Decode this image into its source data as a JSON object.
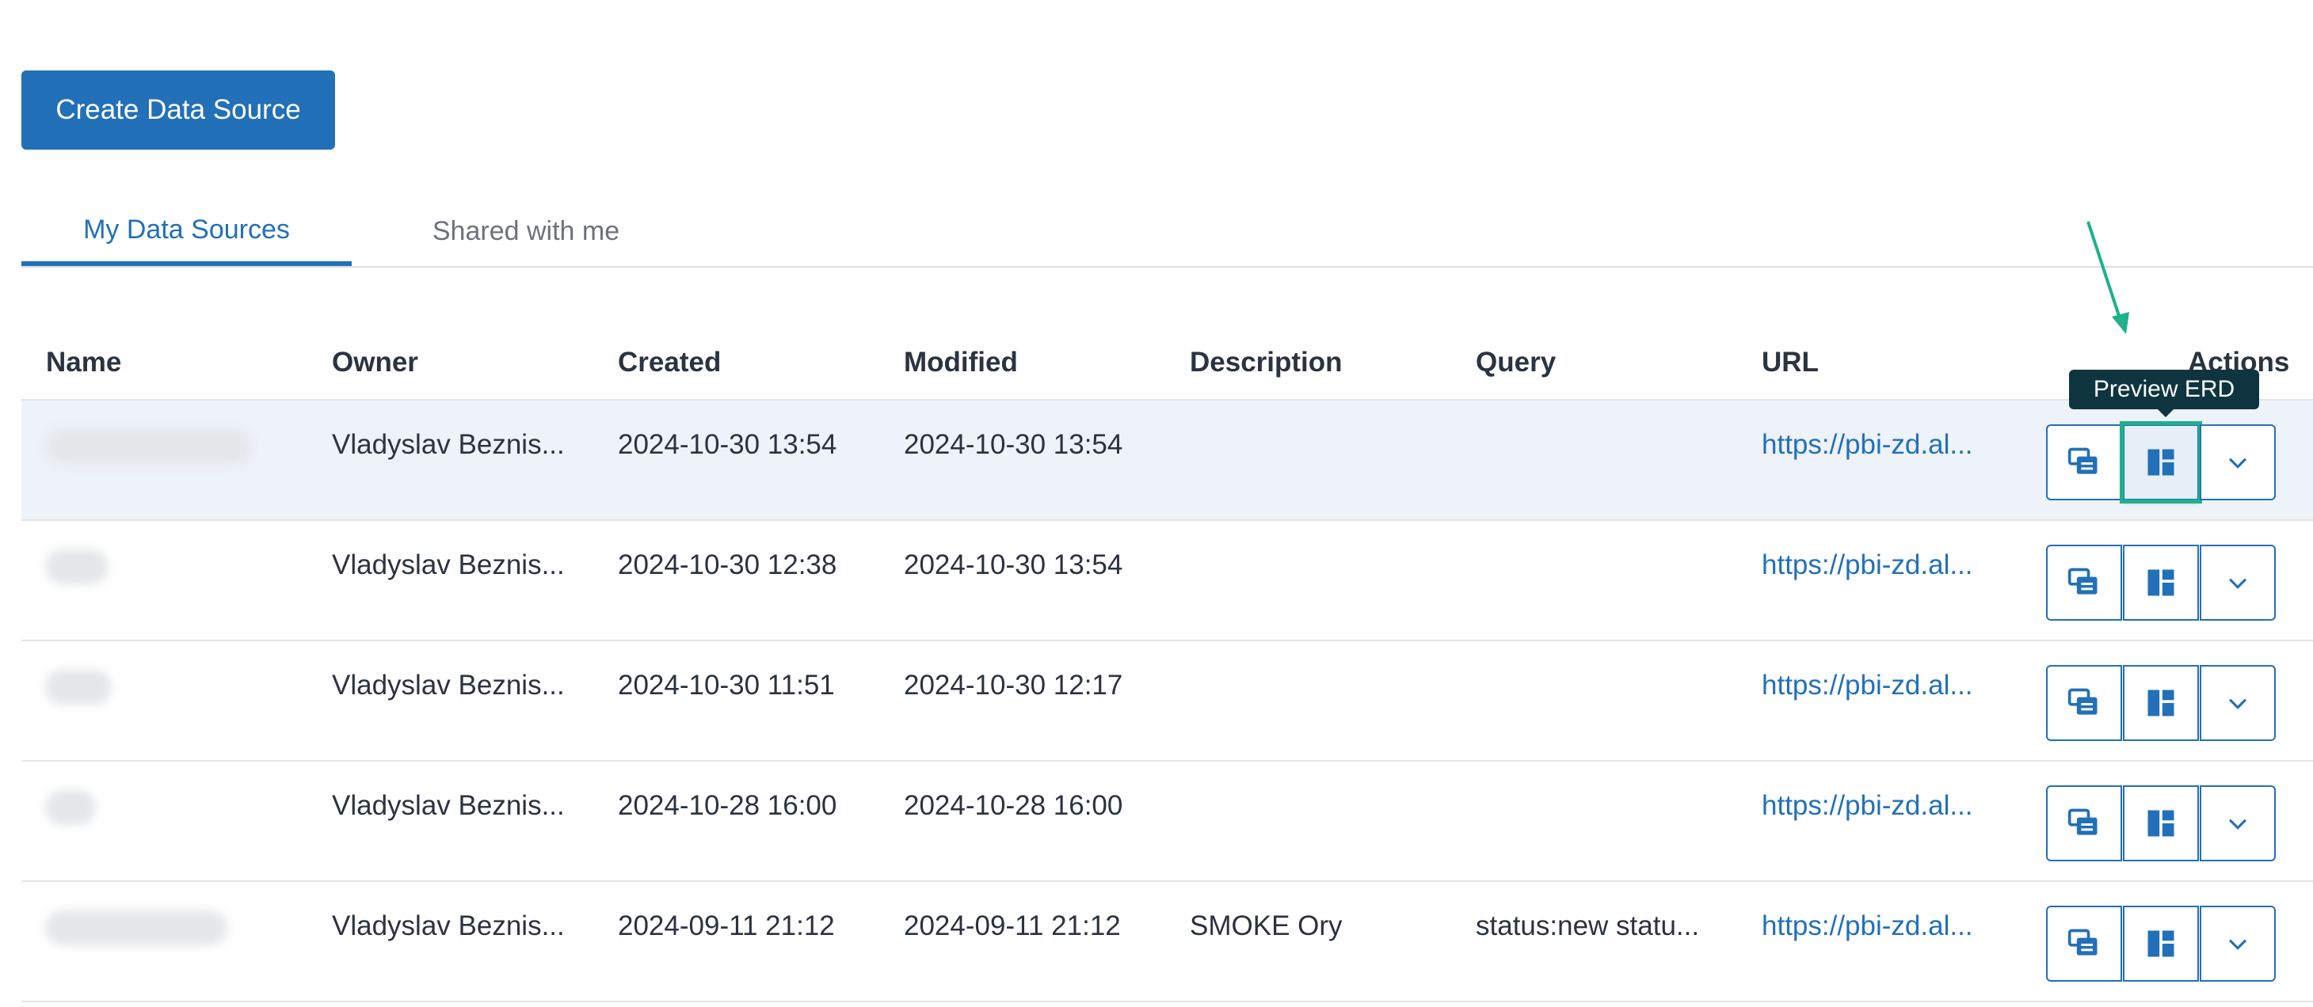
{
  "toolbar": {
    "create_label": "Create Data Source"
  },
  "tabs": [
    {
      "label": "My Data Sources",
      "active": true
    },
    {
      "label": "Shared with me",
      "active": false
    }
  ],
  "table": {
    "headers": [
      "Name",
      "Owner",
      "Created",
      "Modified",
      "Description",
      "Query",
      "URL",
      "Actions"
    ],
    "rows": [
      {
        "name": "",
        "owner": "Vladyslav Beznis...",
        "created": "2024-10-30 13:54",
        "modified": "2024-10-30 13:54",
        "description": "",
        "query": "",
        "url": "https://pbi-zd.al..."
      },
      {
        "name": "",
        "owner": "Vladyslav Beznis...",
        "created": "2024-10-30 12:38",
        "modified": "2024-10-30 13:54",
        "description": "",
        "query": "",
        "url": "https://pbi-zd.al..."
      },
      {
        "name": "",
        "owner": "Vladyslav Beznis...",
        "created": "2024-10-30 11:51",
        "modified": "2024-10-30 12:17",
        "description": "",
        "query": "",
        "url": "https://pbi-zd.al..."
      },
      {
        "name": "",
        "owner": "Vladyslav Beznis...",
        "created": "2024-10-28 16:00",
        "modified": "2024-10-28 16:00",
        "description": "",
        "query": "",
        "url": "https://pbi-zd.al..."
      },
      {
        "name": "",
        "owner": "Vladyslav Beznis...",
        "created": "2024-09-11 21:12",
        "modified": "2024-09-11 21:12",
        "description": "SMOKE Ory",
        "query": "status:new statu...",
        "url": "https://pbi-zd.al..."
      }
    ]
  },
  "tooltip": {
    "text": "Preview ERD"
  },
  "icons": {
    "action_1": "copy-list-icon",
    "action_2": "erd-layout-icon",
    "action_3": "chevron-down-icon"
  },
  "colors": {
    "accent": "#2270b8",
    "highlight": "#1fb08c",
    "tooltip_bg": "#0e3440"
  }
}
